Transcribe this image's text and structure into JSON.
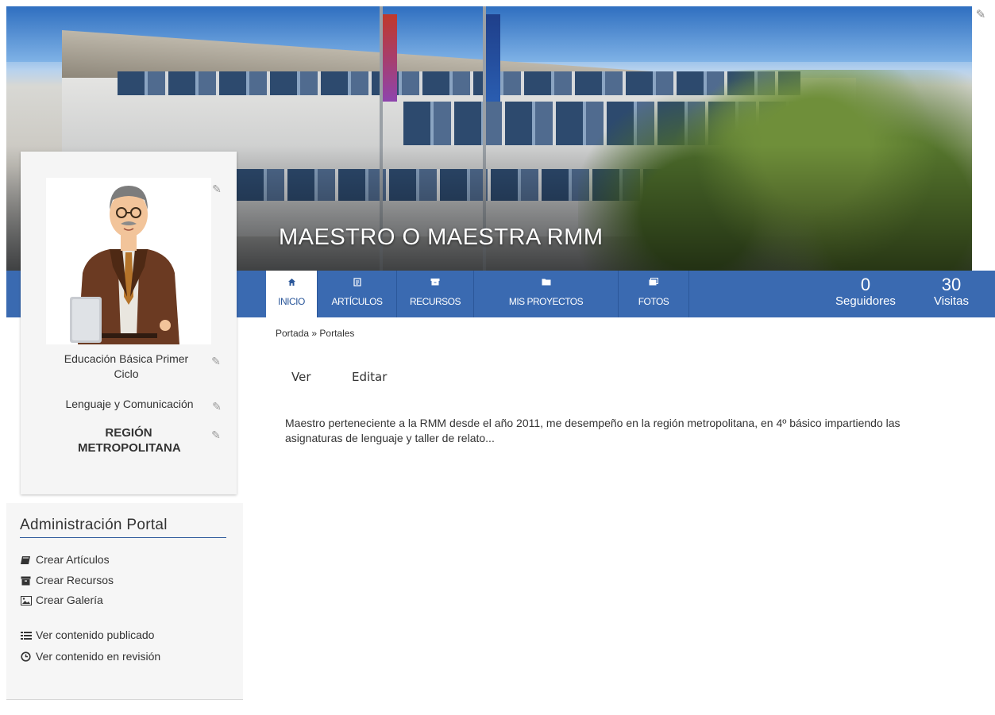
{
  "banner": {
    "title": "MAESTRO O MAESTRA RMM",
    "edit_icon": "edit-icon"
  },
  "nav": {
    "tabs": [
      {
        "label": "INICIO",
        "icon": "home-icon",
        "glyph": "⌂",
        "active": true
      },
      {
        "label": "ARTÍCULOS",
        "icon": "article-icon",
        "glyph": "▤",
        "active": false
      },
      {
        "label": "RECURSOS",
        "icon": "resources-icon",
        "glyph": "▬",
        "active": false
      },
      {
        "label": "MIS PROYECTOS",
        "icon": "folder-icon",
        "glyph": "▬",
        "active": false
      },
      {
        "label": "FOTOS",
        "icon": "photos-icon",
        "glyph": "▣",
        "active": false
      }
    ],
    "stats": [
      {
        "value": "0",
        "label": "Seguidores"
      },
      {
        "value": "30",
        "label": "Visitas"
      }
    ]
  },
  "profile": {
    "avatar_icon": "teacher-avatar",
    "level": "Educación Básica Primer Ciclo",
    "subject": "Lenguaje y Comunicación",
    "region": "REGIÓN METROPOLITANA"
  },
  "breadcrumb": {
    "home": "Portada",
    "separator": "»",
    "current": "Portales"
  },
  "view_tabs": {
    "view": "Ver",
    "edit": "Editar"
  },
  "description": "Maestro perteneciente a la RMM desde el año 2011, me desempeño en la región metropolitana, en 4º básico impartiendo las asignaturas de lenguaje y taller de relato...",
  "admin": {
    "title": "Administración Portal",
    "links": [
      {
        "label": "Crear Artículos",
        "icon": "book-icon"
      },
      {
        "label": "Crear Recursos",
        "icon": "archive-icon"
      },
      {
        "label": "Crear Galería",
        "icon": "image-icon"
      }
    ],
    "links2": [
      {
        "label": "Ver contenido publicado",
        "icon": "list-icon"
      },
      {
        "label": "Ver contenido en revisión",
        "icon": "clock-icon"
      }
    ]
  },
  "colors": {
    "nav_blue": "#3a6ab1",
    "nav_border": "#2b579a",
    "panel_bg": "#f5f5f5"
  }
}
